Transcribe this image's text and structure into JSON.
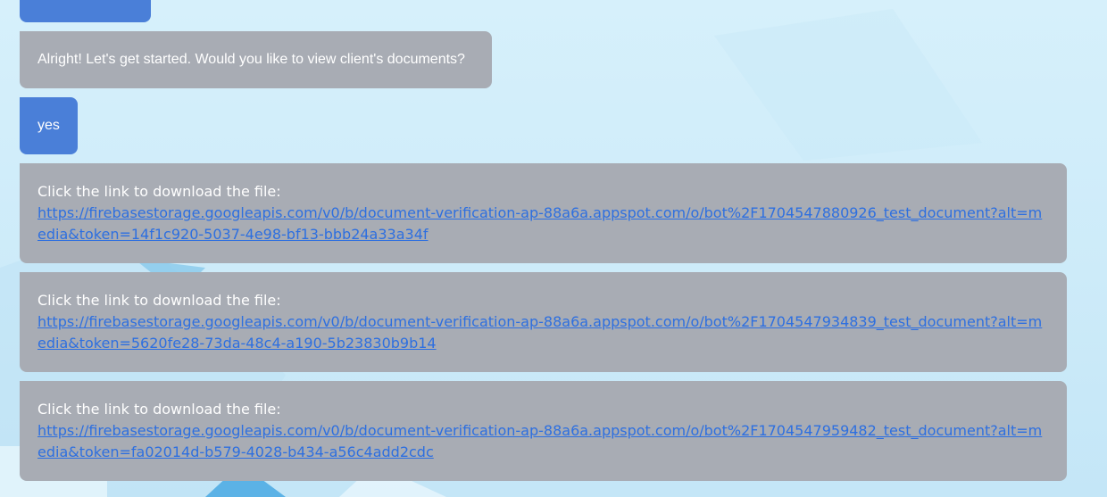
{
  "messages": [
    {
      "role": "user",
      "text": ""
    },
    {
      "role": "bot",
      "text": "Alright! Let's get started. Would you like to view client's documents?"
    },
    {
      "role": "user",
      "text": "yes"
    },
    {
      "role": "bot",
      "prompt": "Click the link to download the file:",
      "link": "https://firebasestorage.googleapis.com/v0/b/document-verification-ap-88a6a.appspot.com/o/bot%2F1704547880926_test_document?alt=media&token=14f1c920-5037-4e98-bf13-bbb24a33a34f"
    },
    {
      "role": "bot",
      "prompt": "Click the link to download the file:",
      "link": "https://firebasestorage.googleapis.com/v0/b/document-verification-ap-88a6a.appspot.com/o/bot%2F1704547934839_test_document?alt=media&token=5620fe28-73da-48c4-a190-5b23830b9b14"
    },
    {
      "role": "bot",
      "prompt": "Click the link to download the file:",
      "link": "https://firebasestorage.googleapis.com/v0/b/document-verification-ap-88a6a.appspot.com/o/bot%2F1704547959482_test_document?alt=media&token=fa02014d-b579-4028-b434-a56c4add2cdc"
    }
  ],
  "colors": {
    "user_bubble": "#4a7fd8",
    "bot_bubble": "#a8acb4",
    "link": "#2d6fe0",
    "background": "#d6f0fb"
  }
}
